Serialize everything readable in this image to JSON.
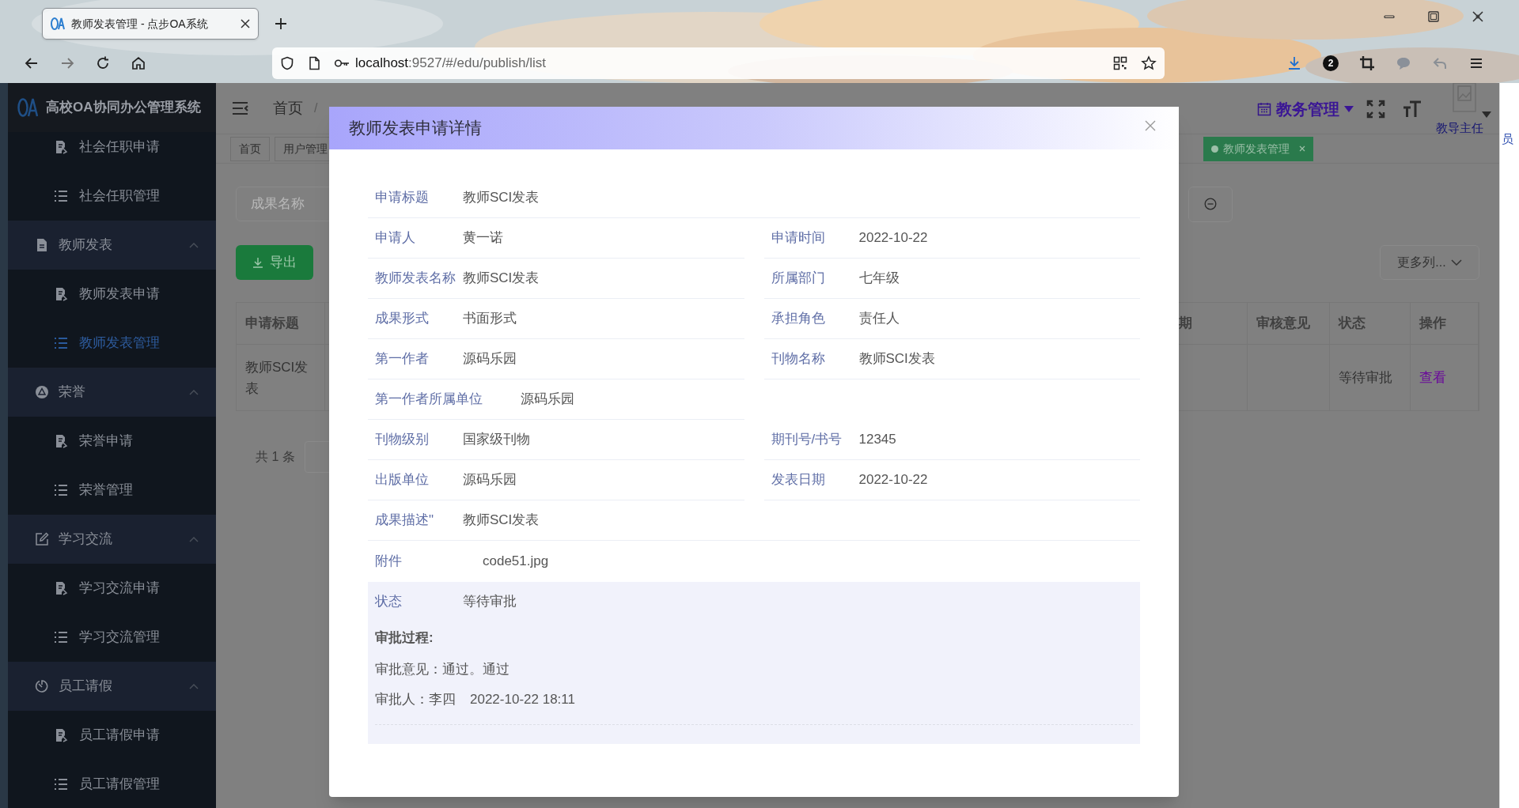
{
  "browser": {
    "tab_title": "教师发表管理 - 点步OA系统",
    "url_host": "localhost",
    "url_path": ":9527/#/edu/publish/list",
    "downloads_badge": "2"
  },
  "side_window": {
    "text": "员"
  },
  "sidebar": {
    "brand": "高校OA协同办公管理系统",
    "items": [
      {
        "kind": "form",
        "label": "社会任职申请",
        "selected": false
      },
      {
        "kind": "list",
        "label": "社会任职管理",
        "selected": false
      },
      {
        "kind": "group",
        "label": "教师发表",
        "expanded": true,
        "children": [
          {
            "kind": "form",
            "label": "教师发表申请",
            "selected": false
          },
          {
            "kind": "list",
            "label": "教师发表管理",
            "selected": true
          }
        ]
      },
      {
        "kind": "group",
        "label": "荣誉",
        "expanded": true,
        "children": [
          {
            "kind": "form",
            "label": "荣誉申请",
            "selected": false
          },
          {
            "kind": "list",
            "label": "荣誉管理",
            "selected": false
          }
        ]
      },
      {
        "kind": "group",
        "label": "学习交流",
        "expanded": true,
        "children": [
          {
            "kind": "form",
            "label": "学习交流申请",
            "selected": false
          },
          {
            "kind": "list",
            "label": "学习交流管理",
            "selected": false
          }
        ]
      },
      {
        "kind": "group",
        "label": "员工请假",
        "expanded": true,
        "children": [
          {
            "kind": "form",
            "label": "员工请假申请",
            "selected": false
          },
          {
            "kind": "list",
            "label": "员工请假管理",
            "selected": false
          }
        ]
      }
    ]
  },
  "header": {
    "breadcrumb": [
      "首页"
    ],
    "breadcrumb_separator": "/",
    "module_menu": "教务管理",
    "user_role": "教导主任"
  },
  "tags": [
    {
      "label": "首页",
      "selected": false
    },
    {
      "label": "用户管理",
      "selected": false
    },
    {
      "label": "教师发表管理",
      "selected": true
    }
  ],
  "filter": {
    "placeholder": "成果名称"
  },
  "toolbar": {
    "export": "导出",
    "more_columns": "更多列..."
  },
  "table": {
    "columns": [
      "申请标题",
      "期",
      "审核意见",
      "状态",
      "操作"
    ],
    "rows": [
      {
        "title": "教师SCI发表",
        "status": "等待审批",
        "action": "查看"
      }
    ]
  },
  "pagination": {
    "total": "共 1 条"
  },
  "dialog": {
    "title": "教师发表申请详情",
    "rows": [
      {
        "kind": "full",
        "fields": [
          {
            "label": "申请标题",
            "value": "教师SCI发表"
          }
        ]
      },
      {
        "kind": "pair",
        "fields": [
          {
            "label": "申请人",
            "value": "黄一诺"
          },
          {
            "label": "申请时间",
            "value": "2022-10-22"
          }
        ]
      },
      {
        "kind": "pair",
        "fields": [
          {
            "label": "教师发表名称",
            "value": "教师SCI发表"
          },
          {
            "label": "所属部门",
            "value": "七年级"
          }
        ]
      },
      {
        "kind": "pair",
        "fields": [
          {
            "label": "成果形式",
            "value": "书面形式"
          },
          {
            "label": "承担角色",
            "value": "责任人"
          }
        ]
      },
      {
        "kind": "pair",
        "fields": [
          {
            "label": "第一作者",
            "value": "源码乐园"
          },
          {
            "label": "刊物名称",
            "value": "教师SCI发表"
          }
        ]
      },
      {
        "kind": "half",
        "fields": [
          {
            "label": "第一作者所属单位",
            "value": "源码乐园"
          }
        ]
      },
      {
        "kind": "pair",
        "fields": [
          {
            "label": "刊物级别",
            "value": "国家级刊物"
          },
          {
            "label": "期刊号/书号",
            "value": "12345"
          }
        ]
      },
      {
        "kind": "pair",
        "fields": [
          {
            "label": "出版单位",
            "value": "源码乐园"
          },
          {
            "label": "发表日期",
            "value": "2022-10-22"
          }
        ]
      },
      {
        "kind": "full",
        "fields": [
          {
            "label": "成果描述\"",
            "value": "教师SCI发表"
          }
        ]
      },
      {
        "kind": "file",
        "fields": [
          {
            "label": "附件",
            "value": "code51.jpg"
          }
        ]
      }
    ],
    "status": {
      "label": "状态",
      "value": "等待审批",
      "process_title": "审批过程:",
      "records": [
        {
          "opinion": "审批意见：通过。通过",
          "approver": "审批人：李四",
          "time": "2022-10-22 18:11"
        }
      ]
    }
  }
}
